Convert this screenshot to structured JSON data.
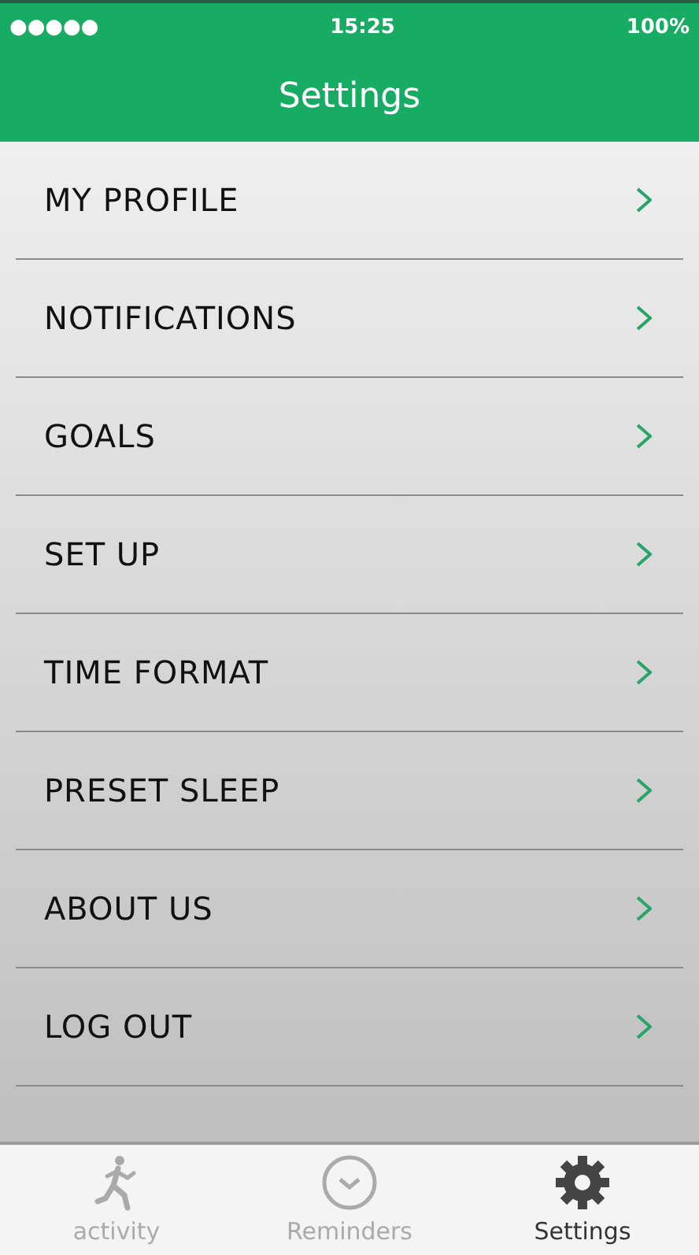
{
  "status_bar": {
    "signal": "●●●●●",
    "time": "15:25",
    "battery": "100%"
  },
  "header": {
    "title": "Settings"
  },
  "menu": [
    {
      "label": "MY PROFILE"
    },
    {
      "label": "NOTIFICATIONS"
    },
    {
      "label": "GOALS"
    },
    {
      "label": "SET UP"
    },
    {
      "label": "TIME FORMAT"
    },
    {
      "label": "PRESET SLEEP"
    },
    {
      "label": "ABOUT US"
    },
    {
      "label": "LOG OUT"
    }
  ],
  "tabs": [
    {
      "label": "activity",
      "kind": "runner",
      "selected": false
    },
    {
      "label": "Reminders",
      "kind": "clock",
      "selected": false
    },
    {
      "label": "Settings",
      "kind": "gear",
      "selected": true
    }
  ]
}
